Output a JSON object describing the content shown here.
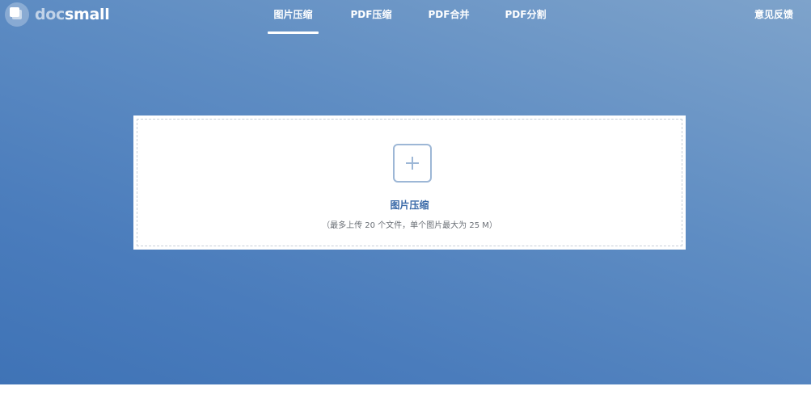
{
  "logo": {
    "part1": "doc",
    "part2": "small"
  },
  "nav": {
    "items": [
      {
        "label": "图片压缩",
        "active": true
      },
      {
        "label": "PDF压缩",
        "active": false
      },
      {
        "label": "PDF合并",
        "active": false
      },
      {
        "label": "PDF分割",
        "active": false
      }
    ],
    "feedback": "意见反馈"
  },
  "upload": {
    "title": "图片压缩",
    "hint": "（最多上传 20 个文件，单个图片最大为 25 M）",
    "icon": "plus-icon"
  },
  "colors": {
    "hero_gradient_start": "#7ea3cb",
    "hero_gradient_end": "#3f73b6",
    "upload_title": "#3b6aa8",
    "plus_border": "#9db7d6"
  }
}
